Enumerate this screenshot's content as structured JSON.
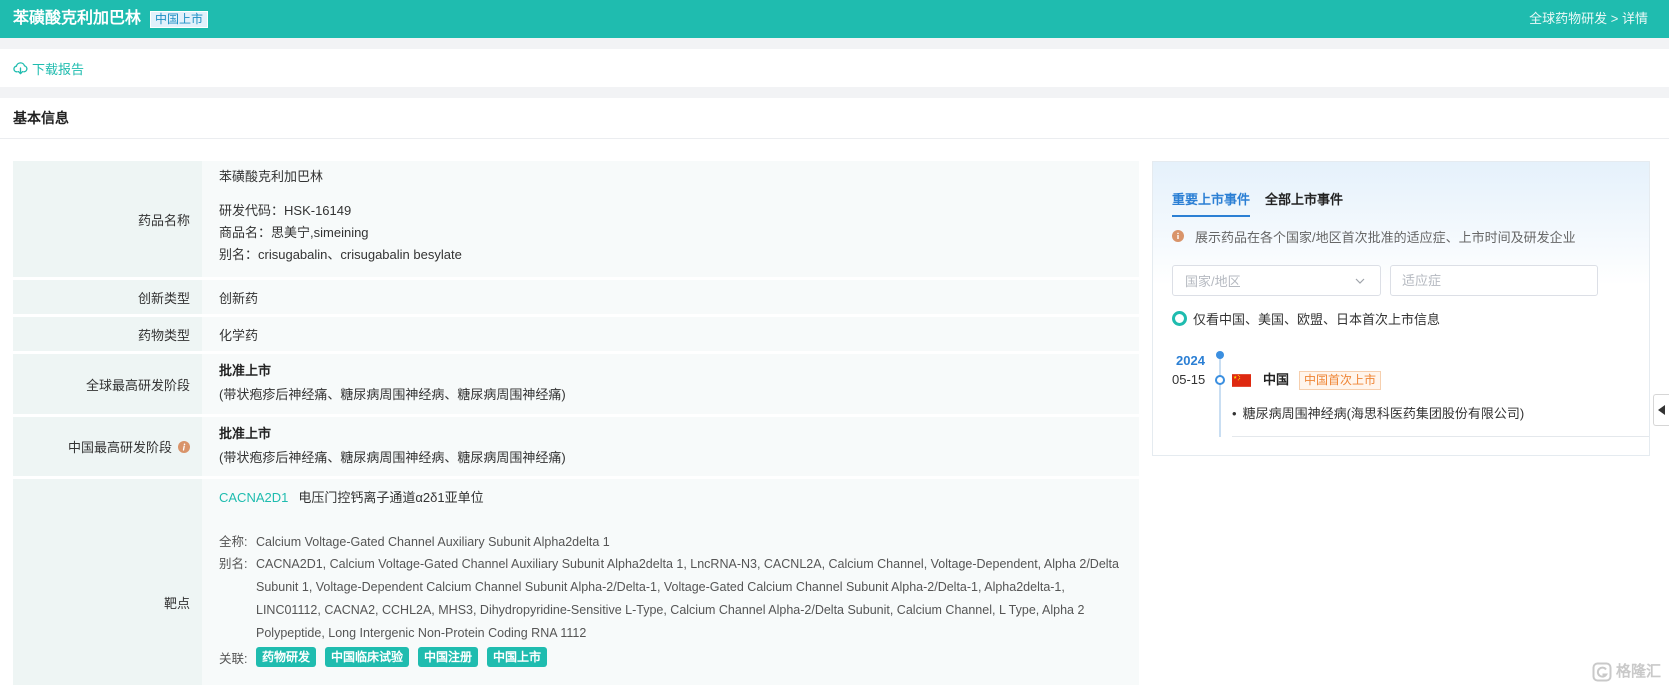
{
  "header": {
    "title": "苯磺酸克利加巴林",
    "status_badge": "中国上市",
    "breadcrumb": "全球药物研发 > 详情"
  },
  "toolbar": {
    "download_label": "下载报告",
    "download_icon": "cloud-download-icon"
  },
  "section_title": "基本信息",
  "basic_info": {
    "drug_name": {
      "label": "药品名称",
      "name": "苯磺酸克利加巴林",
      "code_label": "研发代码：",
      "code": "HSK-16149",
      "trade_name_label": "商品名：",
      "trade_name": "思美宁,simeining",
      "alias_label": "别名：",
      "alias": "crisugabalin、crisugabalin besylate"
    },
    "innovation_type": {
      "label": "创新类型",
      "value": "创新药"
    },
    "drug_type": {
      "label": "药物类型",
      "value": "化学药"
    },
    "global_highest_stage": {
      "label": "全球最高研发阶段",
      "value": "批准上市",
      "indications": "(带状疱疹后神经痛、糖尿病周围神经病、糖尿病周围神经痛)"
    },
    "china_highest_stage": {
      "label": "中国最高研发阶段",
      "value": "批准上市",
      "indications": "(带状疱疹后神经痛、糖尿病周围神经病、糖尿病周围神经痛)"
    },
    "target": {
      "label": "靶点",
      "symbol": "CACNA2D1",
      "description": "电压门控钙离子通道α2δ1亚单位",
      "full_name_label": "全称:",
      "full_name": "Calcium Voltage-Gated Channel Auxiliary Subunit Alpha2delta 1",
      "alias_label": "别名:",
      "alias": "CACNA2D1, Calcium Voltage-Gated Channel Auxiliary Subunit Alpha2delta 1, LncRNA-N3, CACNL2A, Calcium Channel, Voltage-Dependent, Alpha 2/Delta Subunit 1, Voltage-Dependent Calcium Channel Subunit Alpha-2/Delta-1, Voltage-Gated Calcium Channel Subunit Alpha-2/Delta-1, Alpha2delta-1, LINC01112, CACNA2, CCHL2A, MHS3, Dihydropyridine-Sensitive L-Type, Calcium Channel Alpha-2/Delta Subunit, Calcium Channel, L Type, Alpha 2 Polypeptide, Long Intergenic Non-Protein Coding RNA 1112",
      "related_label": "关联:",
      "related_tags": [
        "药物研发",
        "中国临床试验",
        "中国注册",
        "中国上市"
      ]
    }
  },
  "market_events": {
    "tabs": [
      {
        "label": "重要上市事件",
        "active": true
      },
      {
        "label": "全部上市事件",
        "active": false
      }
    ],
    "info_text": "展示药品在各个国家/地区首次批准的适应症、上市时间及研发企业",
    "country_placeholder": "国家/地区",
    "indication_placeholder": "适应症",
    "major_markets_filter_label": "仅看中国、美国、欧盟、日本首次上市信息",
    "timeline": [
      {
        "year": "2024",
        "date": "05-15",
        "country": "中国",
        "country_flag": "china-flag-icon",
        "event_badge": "中国首次上市",
        "items": [
          "糖尿病周围神经病(海思科医药集团股份有限公司)"
        ]
      }
    ]
  },
  "watermark": "格隆汇",
  "colors": {
    "brand": "#1fbcaf",
    "tab_active": "#2b7fd4",
    "badge_orange": "#ef8535",
    "info_icon": "#d9946a"
  }
}
